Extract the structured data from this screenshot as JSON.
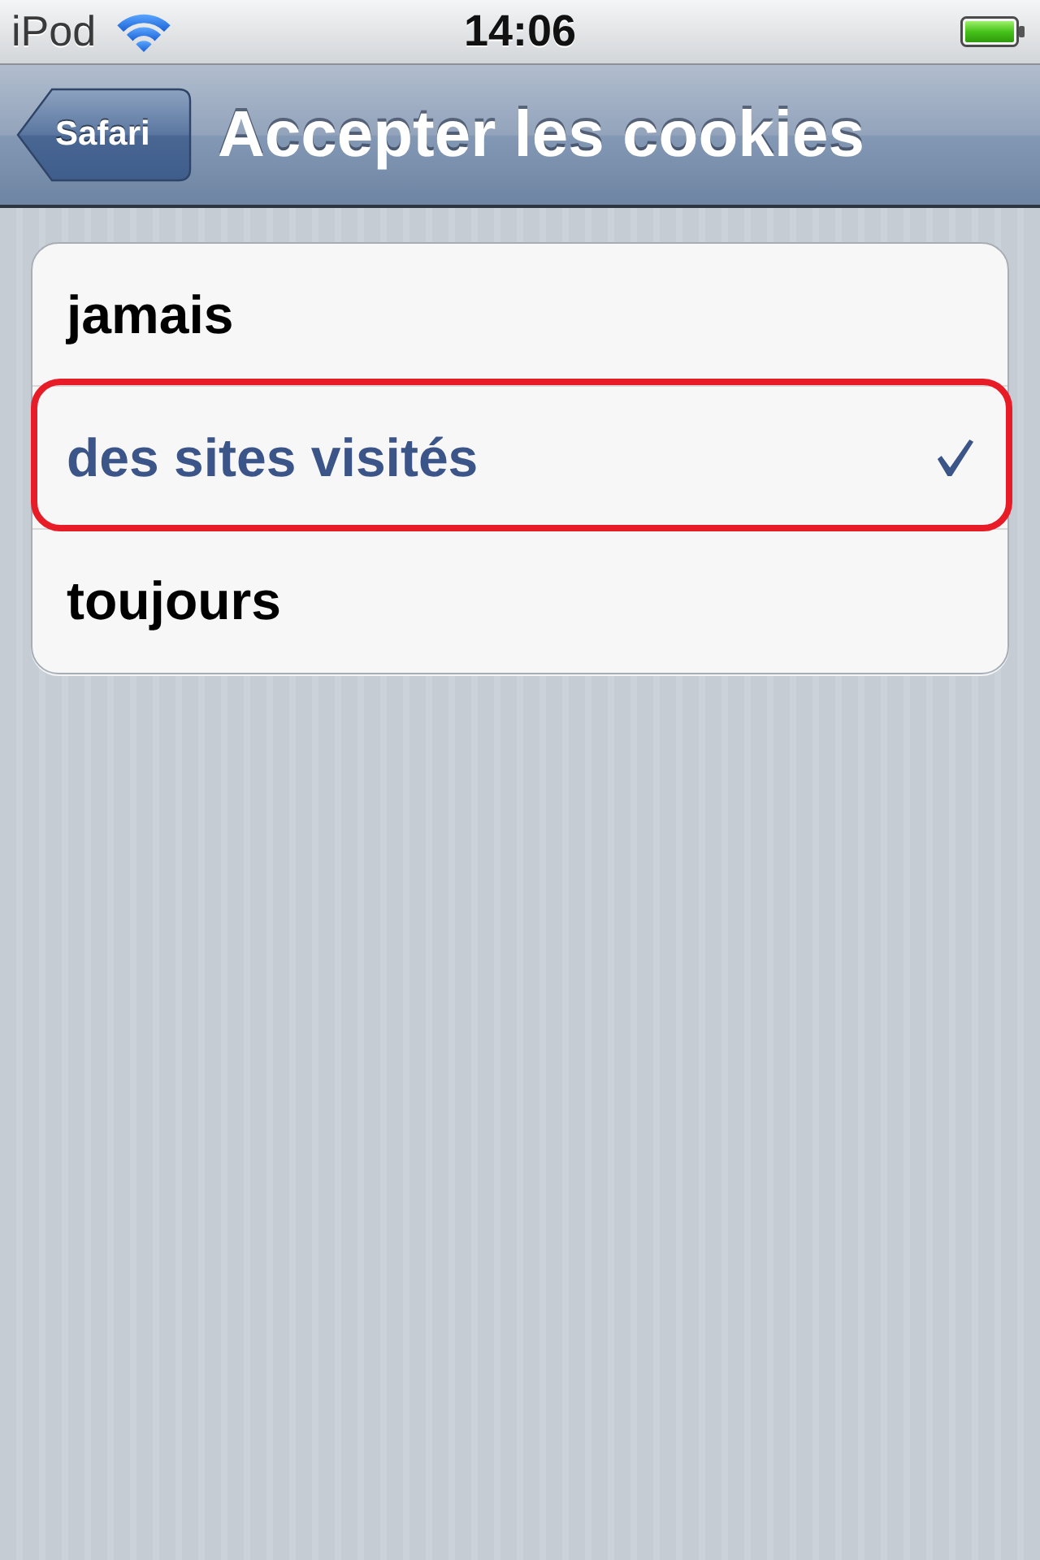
{
  "status_bar": {
    "carrier": "iPod",
    "time": "14:06"
  },
  "nav_bar": {
    "back_button": "Safari",
    "title": "Accepter les cookies"
  },
  "options": [
    {
      "label": "jamais",
      "selected": false,
      "highlighted": false
    },
    {
      "label": "des sites visités",
      "selected": true,
      "highlighted": true
    },
    {
      "label": "toujours",
      "selected": false,
      "highlighted": false
    }
  ]
}
